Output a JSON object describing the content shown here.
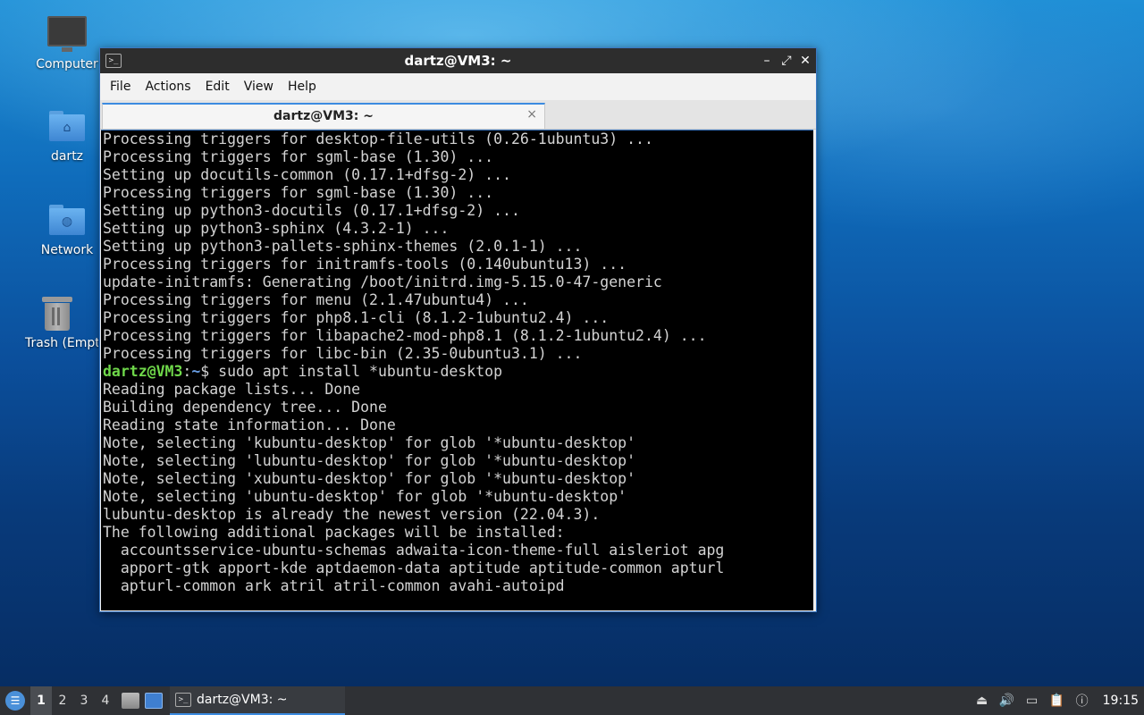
{
  "desktop": {
    "icons": [
      {
        "label": "Computer",
        "icon": "computer-icon"
      },
      {
        "label": "dartz",
        "icon": "home-folder-icon"
      },
      {
        "label": "Network",
        "icon": "network-folder-icon"
      },
      {
        "label": "Trash (Empty)",
        "icon": "trash-icon"
      }
    ]
  },
  "window": {
    "title": "dartz@VM3: ~",
    "menu": [
      "File",
      "Actions",
      "Edit",
      "View",
      "Help"
    ],
    "tab": {
      "label": "dartz@VM3: ~",
      "close": "×"
    },
    "controls": {
      "minimize": "–",
      "maximize": "⤢",
      "close": "✕"
    }
  },
  "terminal": {
    "lines_before": [
      "Processing triggers for desktop-file-utils (0.26-1ubuntu3) ...",
      "Processing triggers for sgml-base (1.30) ...",
      "Setting up docutils-common (0.17.1+dfsg-2) ...",
      "Processing triggers for sgml-base (1.30) ...",
      "Setting up python3-docutils (0.17.1+dfsg-2) ...",
      "Setting up python3-sphinx (4.3.2-1) ...",
      "Setting up python3-pallets-sphinx-themes (2.0.1-1) ...",
      "Processing triggers for initramfs-tools (0.140ubuntu13) ...",
      "update-initramfs: Generating /boot/initrd.img-5.15.0-47-generic",
      "Processing triggers for menu (2.1.47ubuntu4) ...",
      "Processing triggers for php8.1-cli (8.1.2-1ubuntu2.4) ...",
      "Processing triggers for libapache2-mod-php8.1 (8.1.2-1ubuntu2.4) ...",
      "Processing triggers for libc-bin (2.35-0ubuntu3.1) ..."
    ],
    "prompt_user": "dartz@VM3",
    "prompt_sep": ":",
    "prompt_path": "~",
    "command": "$ sudo apt install *ubuntu-desktop",
    "lines_after": [
      "Reading package lists... Done",
      "Building dependency tree... Done",
      "Reading state information... Done",
      "Note, selecting 'kubuntu-desktop' for glob '*ubuntu-desktop'",
      "Note, selecting 'lubuntu-desktop' for glob '*ubuntu-desktop'",
      "Note, selecting 'xubuntu-desktop' for glob '*ubuntu-desktop'",
      "Note, selecting 'ubuntu-desktop' for glob '*ubuntu-desktop'",
      "lubuntu-desktop is already the newest version (22.04.3).",
      "The following additional packages will be installed:",
      "  accountsservice-ubuntu-schemas adwaita-icon-theme-full aisleriot apg",
      "  apport-gtk apport-kde aptdaemon-data aptitude aptitude-common apturl",
      "  apturl-common ark atril atril-common avahi-autoipd"
    ]
  },
  "taskbar": {
    "workspaces": [
      "1",
      "2",
      "3",
      "4"
    ],
    "active_workspace": "1",
    "task_label": "dartz@VM3: ~",
    "clock": "19:15"
  }
}
